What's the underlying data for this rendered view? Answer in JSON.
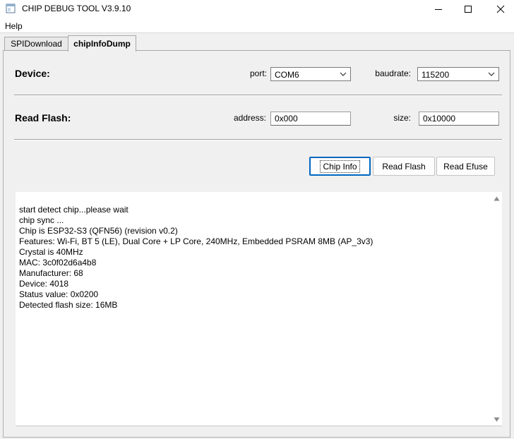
{
  "window": {
    "title": "CHIP DEBUG TOOL V3.9.10",
    "icon": "app-window-icon",
    "controls": [
      "minimize-icon",
      "maximize-icon",
      "close-icon"
    ]
  },
  "menu": {
    "help": "Help"
  },
  "tabs": [
    {
      "label": "SPIDownload",
      "active": false
    },
    {
      "label": "chipInfoDump",
      "active": true
    }
  ],
  "device": {
    "section_label": "Device:",
    "port_label": "port:",
    "port_value": "COM6",
    "baudrate_label": "baudrate:",
    "baudrate_value": "115200"
  },
  "read_flash": {
    "section_label": "Read Flash:",
    "address_label": "address:",
    "address_value": "0x000",
    "size_label": "size:",
    "size_value": "0x10000"
  },
  "buttons": {
    "chip_info": "Chip Info",
    "read_flash": "Read Flash",
    "read_efuse": "Read Efuse"
  },
  "log": {
    "lines": [
      "start detect chip...please wait",
      "chip sync ...",
      "Chip is ESP32-S3 (QFN56) (revision v0.2)",
      "Features: Wi-Fi, BT 5 (LE), Dual Core + LP Core, 240MHz, Embedded PSRAM 8MB (AP_3v3)",
      "Crystal is 40MHz",
      "MAC: 3c0f02d6a4b8",
      "Manufacturer: 68",
      "Device: 4018",
      "Status value: 0x0200",
      "Detected flash size: 16MB"
    ]
  },
  "colors": {
    "focus_accent": "#0067c0",
    "window_bg": "#f0f0f0"
  }
}
